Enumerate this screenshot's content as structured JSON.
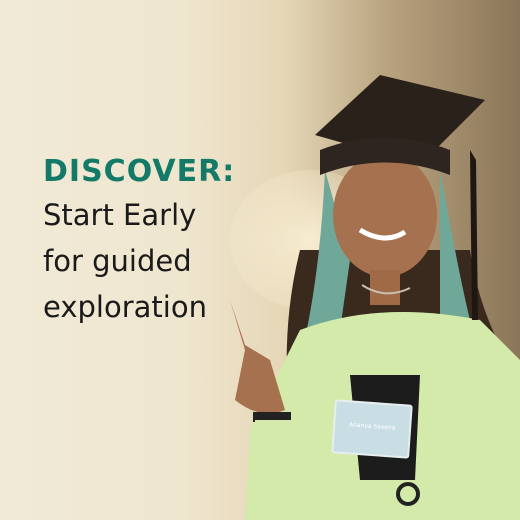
{
  "headline": "DISCOVER:",
  "lines": [
    "Start Early",
    "for guided",
    "exploration"
  ],
  "badge_name": "Ananya Saxena",
  "colors": {
    "headline": "#137a68",
    "text": "#1a1a1a",
    "top": "#c8e6a0"
  }
}
